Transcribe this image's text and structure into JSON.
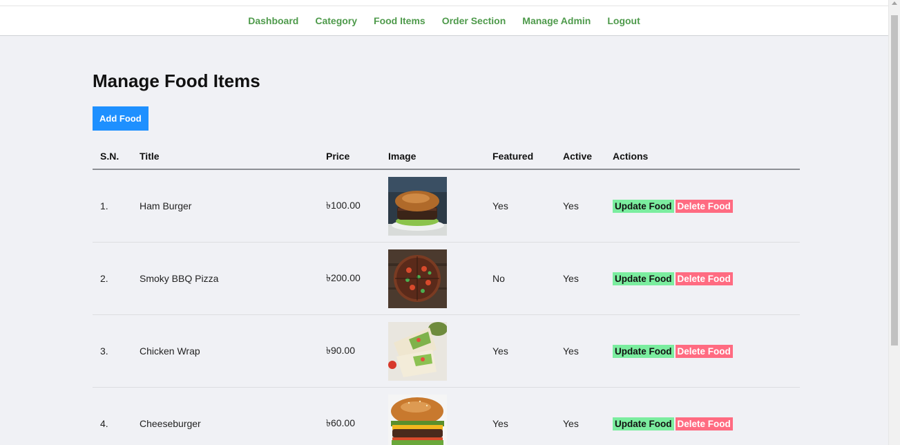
{
  "nav": {
    "items": [
      {
        "label": "Dashboard"
      },
      {
        "label": "Category"
      },
      {
        "label": "Food Items"
      },
      {
        "label": "Order Section"
      },
      {
        "label": "Manage Admin"
      },
      {
        "label": "Logout"
      }
    ]
  },
  "page": {
    "title": "Manage Food Items",
    "add_button": "Add Food"
  },
  "table": {
    "headers": {
      "sn": "S.N.",
      "title": "Title",
      "price": "Price",
      "image": "Image",
      "featured": "Featured",
      "active": "Active",
      "actions": "Actions"
    },
    "rows": [
      {
        "sn": "1.",
        "title": "Ham Burger",
        "price": "৳100.00",
        "image": "burger-photo",
        "featured": "Yes",
        "active": "Yes",
        "update": "Update Food",
        "delete": "Delete Food"
      },
      {
        "sn": "2.",
        "title": "Smoky BBQ Pizza",
        "price": "৳200.00",
        "image": "pizza-photo",
        "featured": "No",
        "active": "Yes",
        "update": "Update Food",
        "delete": "Delete Food"
      },
      {
        "sn": "3.",
        "title": "Chicken Wrap",
        "price": "৳90.00",
        "image": "wrap-photo",
        "featured": "Yes",
        "active": "Yes",
        "update": "Update Food",
        "delete": "Delete Food"
      },
      {
        "sn": "4.",
        "title": "Cheeseburger",
        "price": "৳60.00",
        "image": "cheeseburger-photo",
        "featured": "Yes",
        "active": "Yes",
        "update": "Update Food",
        "delete": "Delete Food"
      }
    ]
  },
  "colors": {
    "nav_link": "#4e9a4b",
    "add_button": "#1e90ff",
    "update_button": "#7bed9f",
    "delete_button": "#ff6b81",
    "page_bg": "#f0f1f5"
  }
}
